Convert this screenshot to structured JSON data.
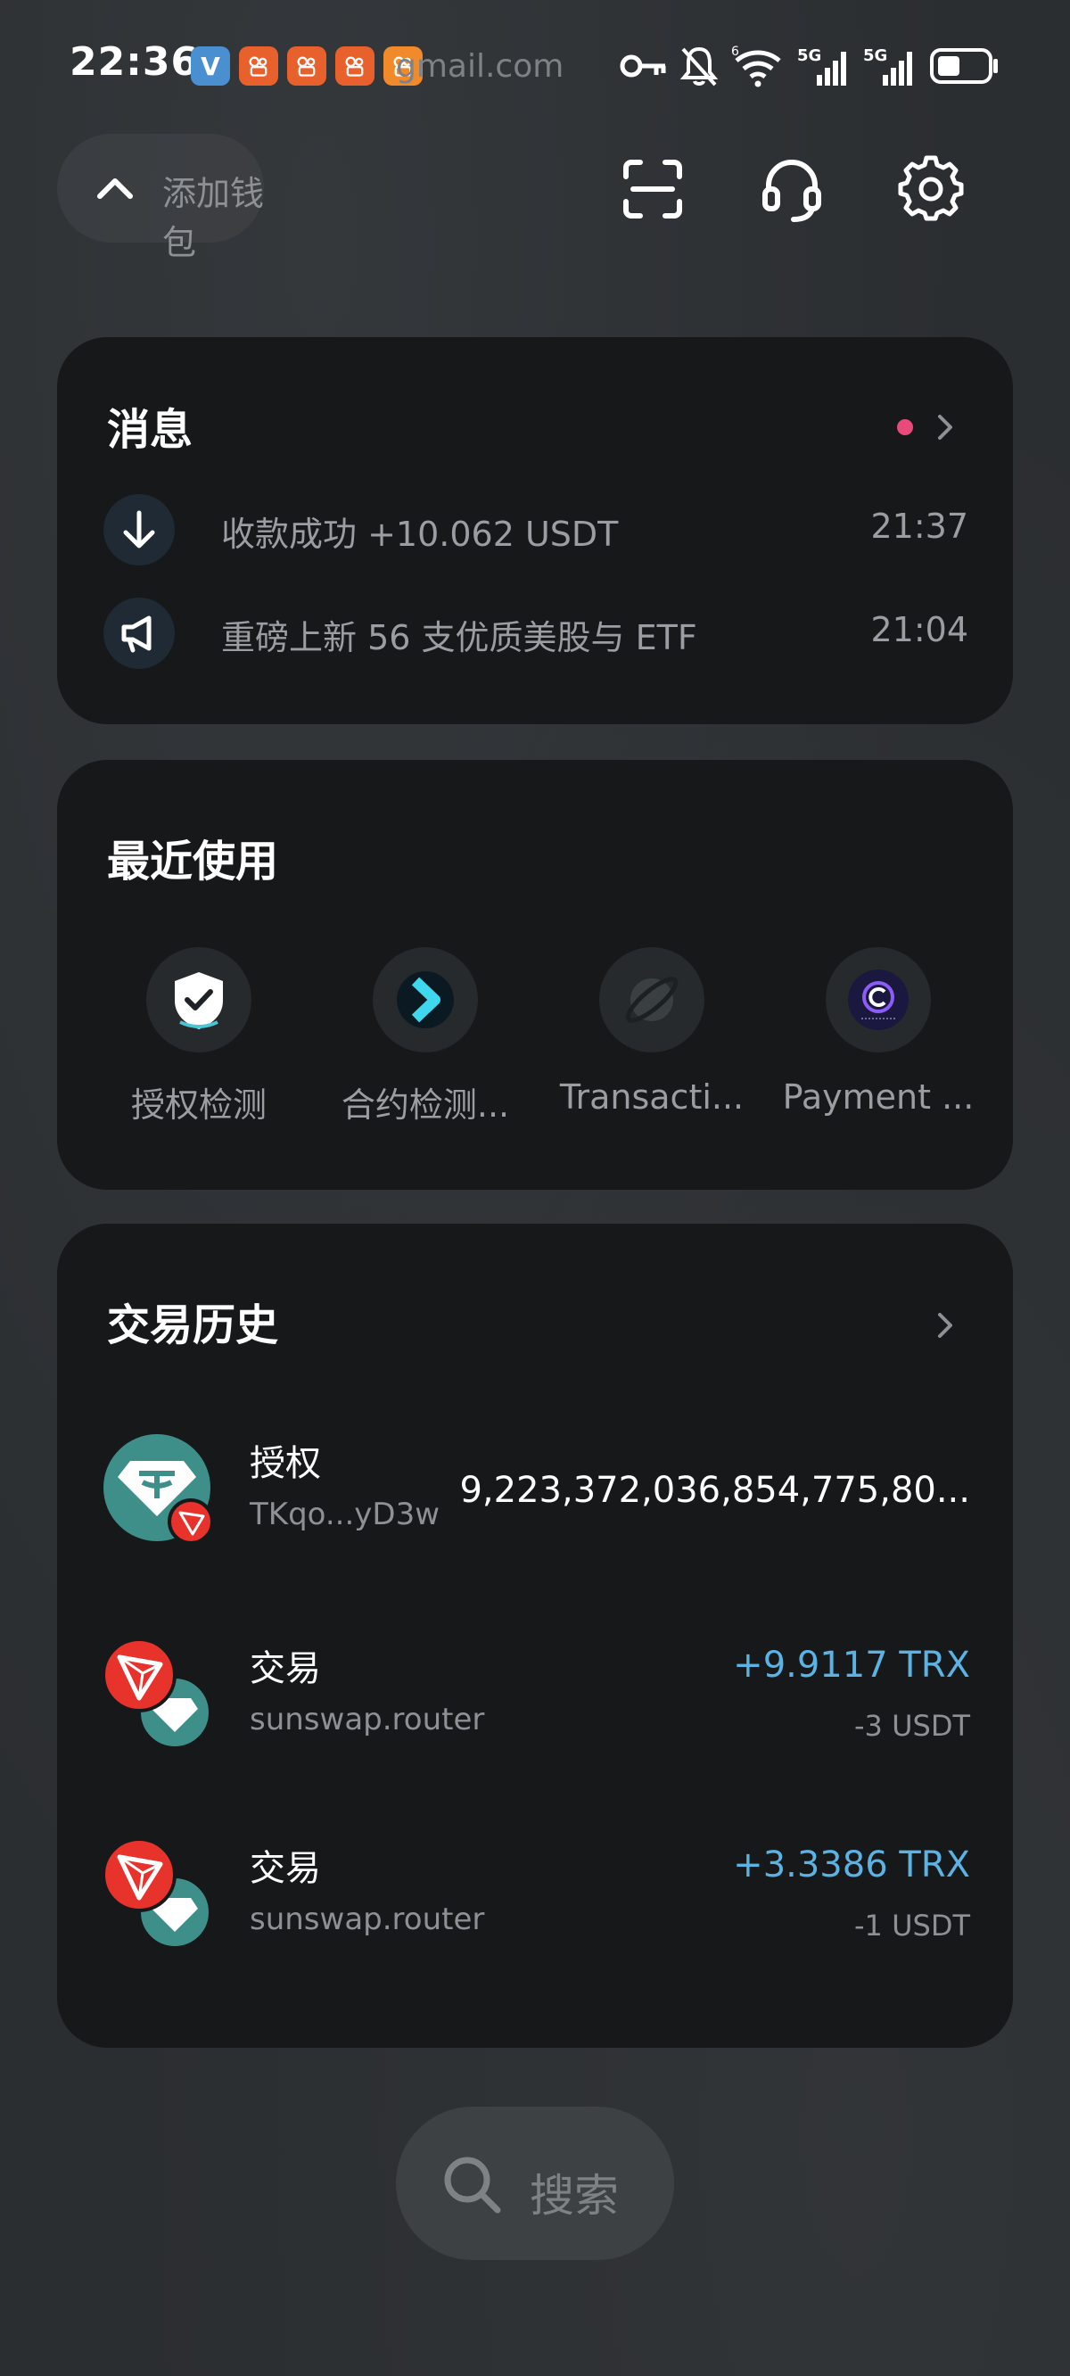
{
  "status_bar": {
    "time": "22:36",
    "app_v": "V",
    "email_fragment": "gmail.com",
    "network_label_1": "5G",
    "network_label_2": "5G",
    "wifi_label": "6"
  },
  "header": {
    "wallet_label": "添加钱包"
  },
  "messages": {
    "title": "消息",
    "items": [
      {
        "text": "收款成功 +10.062 USDT",
        "time": "21:37",
        "icon": "arrow-down-icon"
      },
      {
        "text": "重磅上新 56 支优质美股与 ETF",
        "time": "21:04",
        "icon": "megaphone-icon"
      }
    ]
  },
  "recent": {
    "title": "最近使用",
    "items": [
      {
        "label": "授权检测",
        "icon": "shield-check-icon"
      },
      {
        "label": "合约检测...",
        "icon": "chevron-app-icon"
      },
      {
        "label": "Transacti...",
        "icon": "planet-icon"
      },
      {
        "label": "Payment ...",
        "icon": "coin-c-icon"
      }
    ]
  },
  "history": {
    "title": "交易历史",
    "items": [
      {
        "title": "授权",
        "subtitle": "TKqo...yD3w",
        "amount": "9,223,372,036,854,775,80...",
        "amount_sub": ""
      },
      {
        "title": "交易",
        "subtitle": "sunswap.router",
        "amount": "+9.9117 TRX",
        "amount_sub": "-3 USDT"
      },
      {
        "title": "交易",
        "subtitle": "sunswap.router",
        "amount": "+3.3386 TRX",
        "amount_sub": "-1 USDT"
      }
    ]
  },
  "search": {
    "label": "搜索"
  },
  "colors": {
    "positive": "#5bb3e4",
    "usdt": "#3e8f8a",
    "tron": "#e8322c",
    "badge": "#e84a7a"
  }
}
